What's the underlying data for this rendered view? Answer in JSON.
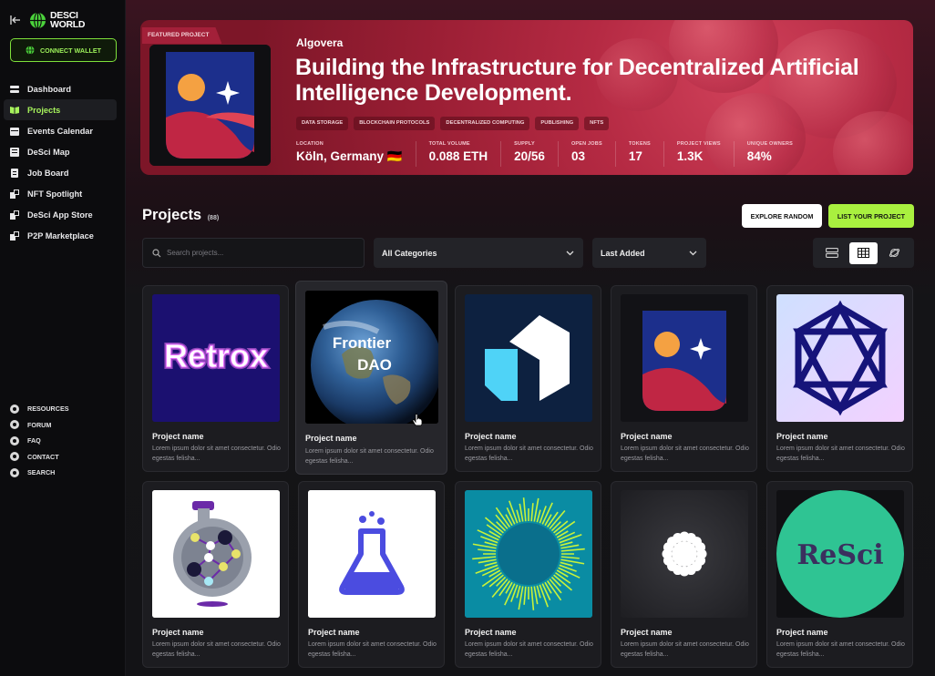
{
  "brand": {
    "line1": "DESCI",
    "line2": "WORLD"
  },
  "sidebar": {
    "connect_wallet": "CONNECT WALLET",
    "items": [
      {
        "label": "Dashboard",
        "icon": "dashboard-icon"
      },
      {
        "label": "Projects",
        "icon": "book-icon",
        "active": true
      },
      {
        "label": "Events Calendar",
        "icon": "calendar-icon"
      },
      {
        "label": "DeSci Map",
        "icon": "map-icon"
      },
      {
        "label": "Job Board",
        "icon": "clipboard-icon"
      },
      {
        "label": "NFT Spotlight",
        "icon": "nft-icon"
      },
      {
        "label": "DeSci App Store",
        "icon": "store-icon"
      },
      {
        "label": "P2P Marketplace",
        "icon": "marketplace-icon"
      }
    ],
    "footer": [
      {
        "label": "RESOURCES"
      },
      {
        "label": "FORUM"
      },
      {
        "label": "FAQ"
      },
      {
        "label": "CONTACT"
      },
      {
        "label": "SEARCH"
      }
    ]
  },
  "featured": {
    "tab": "FEATURED PROJECT",
    "name": "Algovera",
    "title": "Building the Infrastructure for Decentralized Artificial Intelligence Development.",
    "tags": [
      "DATA STORAGE",
      "BLOCKCHAIN PROTOCOLS",
      "DECENTRALIZED COMPUTING",
      "PUBLISHING",
      "NFTS"
    ],
    "stats": [
      {
        "label": "LOCATION",
        "value": "Köln, Germany 🇩🇪"
      },
      {
        "label": "TOTAL VOLUME",
        "value": "0.088 ETH"
      },
      {
        "label": "SUPPLY",
        "value": "20/56"
      },
      {
        "label": "OPEN JOBS",
        "value": "03"
      },
      {
        "label": "TOKENS",
        "value": "17"
      },
      {
        "label": "PROJECT VIEWS",
        "value": "1.3K"
      },
      {
        "label": "UNIQUE OWNERS",
        "value": "84%"
      }
    ]
  },
  "projects": {
    "title": "Projects",
    "count": "(88)",
    "explore_random": "EXPLORE RANDOM",
    "list_project": "LIST YOUR PROJECT",
    "search_placeholder": "Search projects...",
    "category_select": "All Categories",
    "sort_select": "Last Added",
    "cards": [
      {
        "name": "Project name",
        "desc": "Lorem ipsum dolor sit amet consectetur. Odio egestas felisha...",
        "logo": "Retrox"
      },
      {
        "name": "Project name",
        "desc": "Lorem ipsum dolor sit amet consectetur. Odio egestas felisha...",
        "logo": "Frontier DAO"
      },
      {
        "name": "Project name",
        "desc": "Lorem ipsum dolor sit amet consectetur. Odio egestas felisha...",
        "logo": "cube"
      },
      {
        "name": "Project name",
        "desc": "Lorem ipsum dolor sit amet consectetur. Odio egestas felisha...",
        "logo": "algovera"
      },
      {
        "name": "Project name",
        "desc": "Lorem ipsum dolor sit amet consectetur. Odio egestas felisha...",
        "logo": "hexagon"
      },
      {
        "name": "Project name",
        "desc": "Lorem ipsum dolor sit amet consectetur. Odio egestas felisha...",
        "logo": "flask-network"
      },
      {
        "name": "Project name",
        "desc": "Lorem ipsum dolor sit amet consectetur. Odio egestas felisha...",
        "logo": "flask"
      },
      {
        "name": "Project name",
        "desc": "Lorem ipsum dolor sit amet consectetur. Odio egestas felisha...",
        "logo": "sunburst"
      },
      {
        "name": "Project name",
        "desc": "Lorem ipsum dolor sit amet consectetur. Odio egestas felisha...",
        "logo": "starburst"
      },
      {
        "name": "Project name",
        "desc": "Lorem ipsum dolor sit amet consectetur. Odio egestas felisha...",
        "logo": "ReSci"
      }
    ]
  },
  "colors": {
    "accent": "#a9f03f",
    "hero": "#b52a43",
    "background": "#131316"
  }
}
